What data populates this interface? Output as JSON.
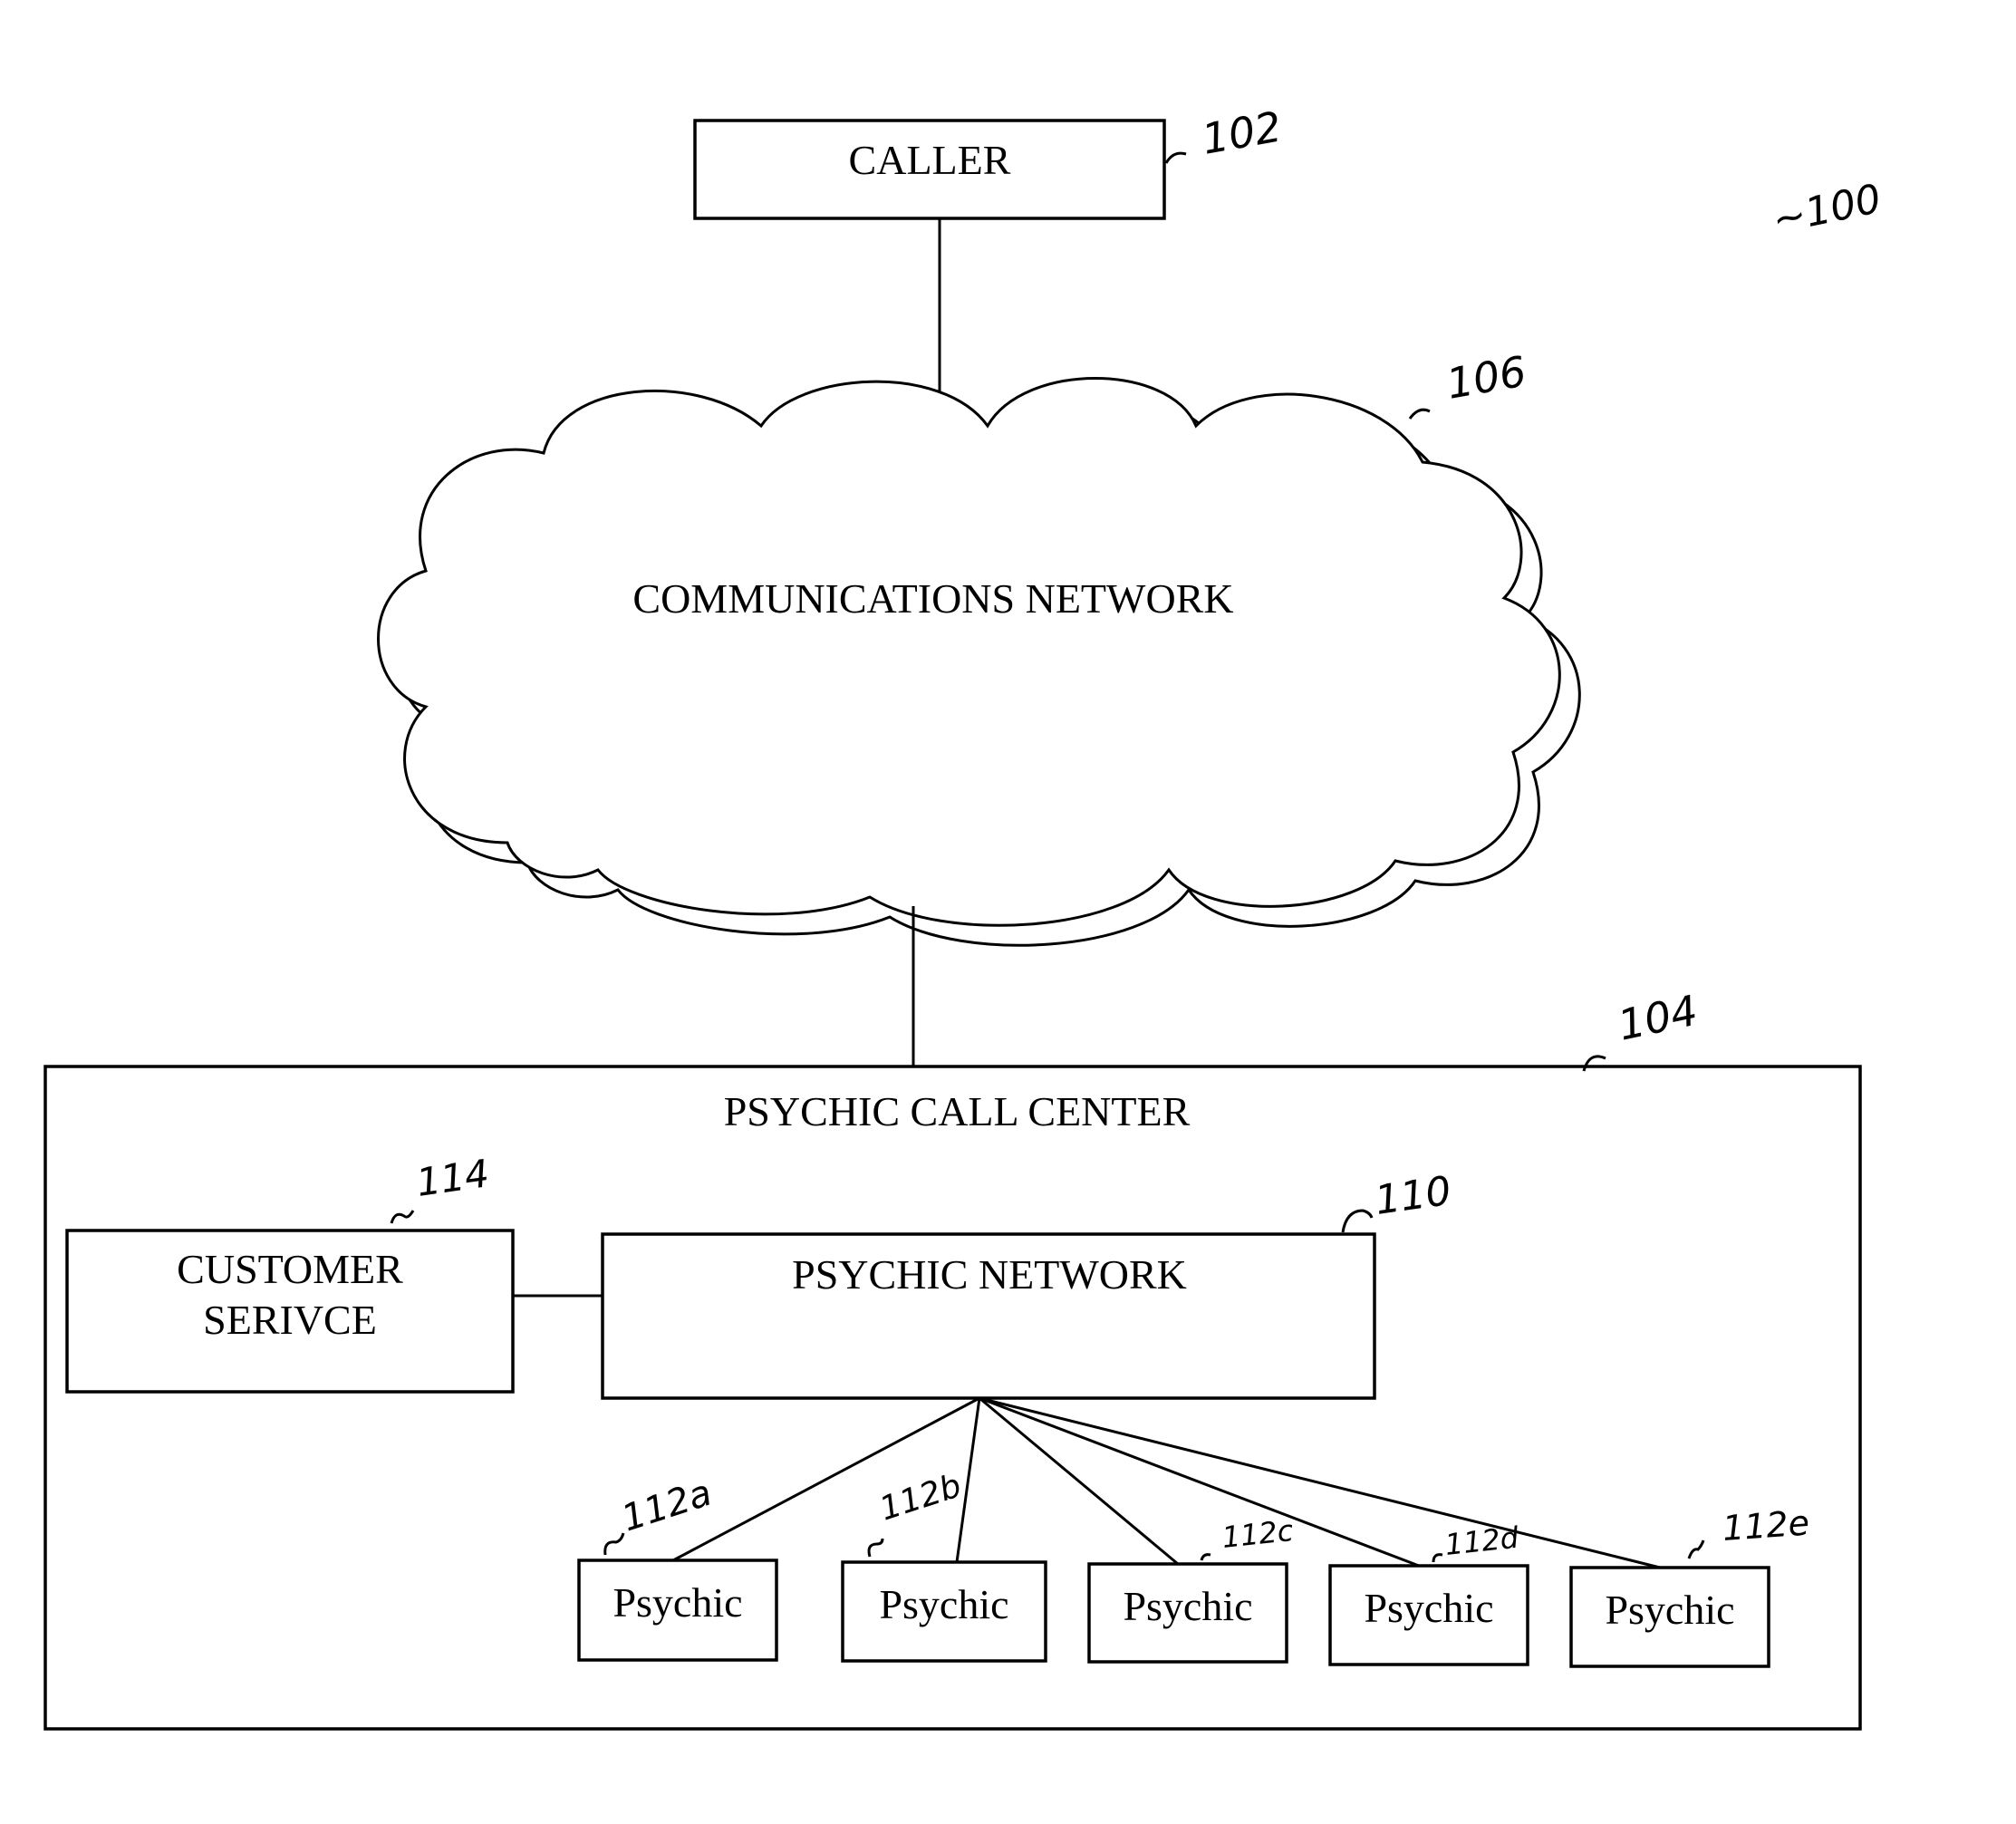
{
  "figure": {
    "ref": "~100",
    "caller": {
      "label": "CALLER",
      "ref": "102"
    },
    "network": {
      "label": "COMMUNICATIONS NETWORK",
      "ref": "106"
    },
    "call_center": {
      "label": "PSYCHIC CALL CENTER",
      "ref": "104",
      "customer_service": {
        "line1": "CUSTOMER",
        "line2": "SERIVCE",
        "ref": "114"
      },
      "psychic_network": {
        "label": "PSYCHIC NETWORK",
        "ref": "110"
      },
      "psychics": [
        {
          "label": "Psychic",
          "ref": "112a"
        },
        {
          "label": "Psychic",
          "ref": "112b"
        },
        {
          "label": "Psychic",
          "ref": "112c"
        },
        {
          "label": "Psychic",
          "ref": "112d"
        },
        {
          "label": "Psychic",
          "ref": "112e"
        }
      ]
    }
  }
}
